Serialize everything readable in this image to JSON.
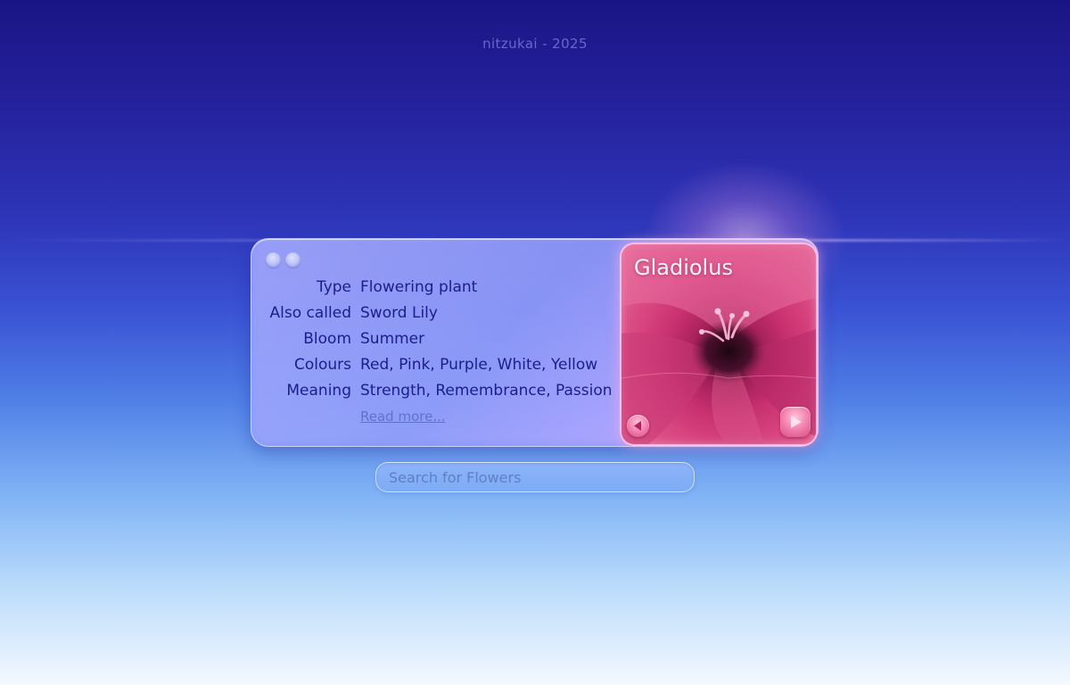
{
  "credit": "nitzukai - 2025",
  "widget": {
    "rows": [
      {
        "label": "Type",
        "value": "Flowering plant"
      },
      {
        "label": "Also called",
        "value": "Sword Lily"
      },
      {
        "label": "Bloom",
        "value": "Summer"
      },
      {
        "label": "Colours",
        "value": "Red, Pink, Purple, White, Yellow"
      },
      {
        "label": "Meaning",
        "value": "Strength, Remembrance, Passion"
      }
    ],
    "read_more": "Read more...",
    "flower_name": "Gladiolus"
  },
  "search": {
    "placeholder": "Search for Flowers"
  },
  "icons": {
    "window_controls": [
      "window-dot-icon",
      "window-dot-icon"
    ],
    "prev": "play-left-icon",
    "next": "play-right-icon"
  },
  "colors": {
    "label_text": "#1c1d8a",
    "link": "#5f73c9",
    "flower_pink": "#d8457f"
  }
}
